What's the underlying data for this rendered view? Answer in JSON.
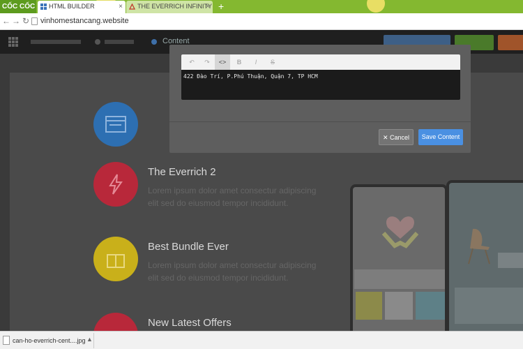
{
  "browser": {
    "brand": "CỐC CỐC",
    "tabs": [
      {
        "title": "HTML BUILDER",
        "close": "×"
      },
      {
        "title": "THE EVERRICH INFINITY -",
        "close": "×"
      }
    ],
    "new_tab": "+",
    "url": "vinhomestancang.website",
    "nav": {
      "back": "←",
      "forward": "→",
      "reload": "↻"
    }
  },
  "app": {
    "menu": [
      {
        "label": "",
        "active": false
      },
      {
        "label": "",
        "active": false
      },
      {
        "label": "Content",
        "active": true
      }
    ],
    "buttons": [
      {
        "label": "",
        "color": "#3d5f86"
      },
      {
        "label": "",
        "color": "#4a7a2a"
      },
      {
        "label": "",
        "color": "#a0542a"
      }
    ]
  },
  "modal": {
    "toolbar": [
      {
        "icon": "undo-icon",
        "glyph": "↶"
      },
      {
        "icon": "redo-icon",
        "glyph": "↷"
      },
      {
        "icon": "code-icon",
        "glyph": "<>"
      },
      {
        "icon": "bold-icon",
        "glyph": "B"
      },
      {
        "icon": "italic-icon",
        "glyph": "I"
      },
      {
        "icon": "strikethrough-icon",
        "glyph": "S"
      }
    ],
    "content": "422 Đào Trí, P.Phú Thuận, Quận 7, TP HCM",
    "cancel_label": "✕ Cancel",
    "save_label": "Save Content"
  },
  "page": {
    "features": [
      {
        "title": "",
        "text": "",
        "color": "#2d6fb2"
      },
      {
        "title": "The Everrich 2",
        "text": "Lorem ipsum dolor amet consectur adipiscing elit sed do eiusmod tempor incididunt.",
        "color": "#b8283a"
      },
      {
        "title": "Best Bundle Ever",
        "text": "Lorem ipsum dolor amet consectur adipiscing elit sed do eiusmod tempor incididunt.",
        "color": "#c9b01a"
      },
      {
        "title": "New Latest Offers",
        "text": "",
        "color": "#b8283a"
      }
    ]
  },
  "downloads": {
    "file": "can-ho-everrich-cent....jpg",
    "caret": "▲"
  }
}
